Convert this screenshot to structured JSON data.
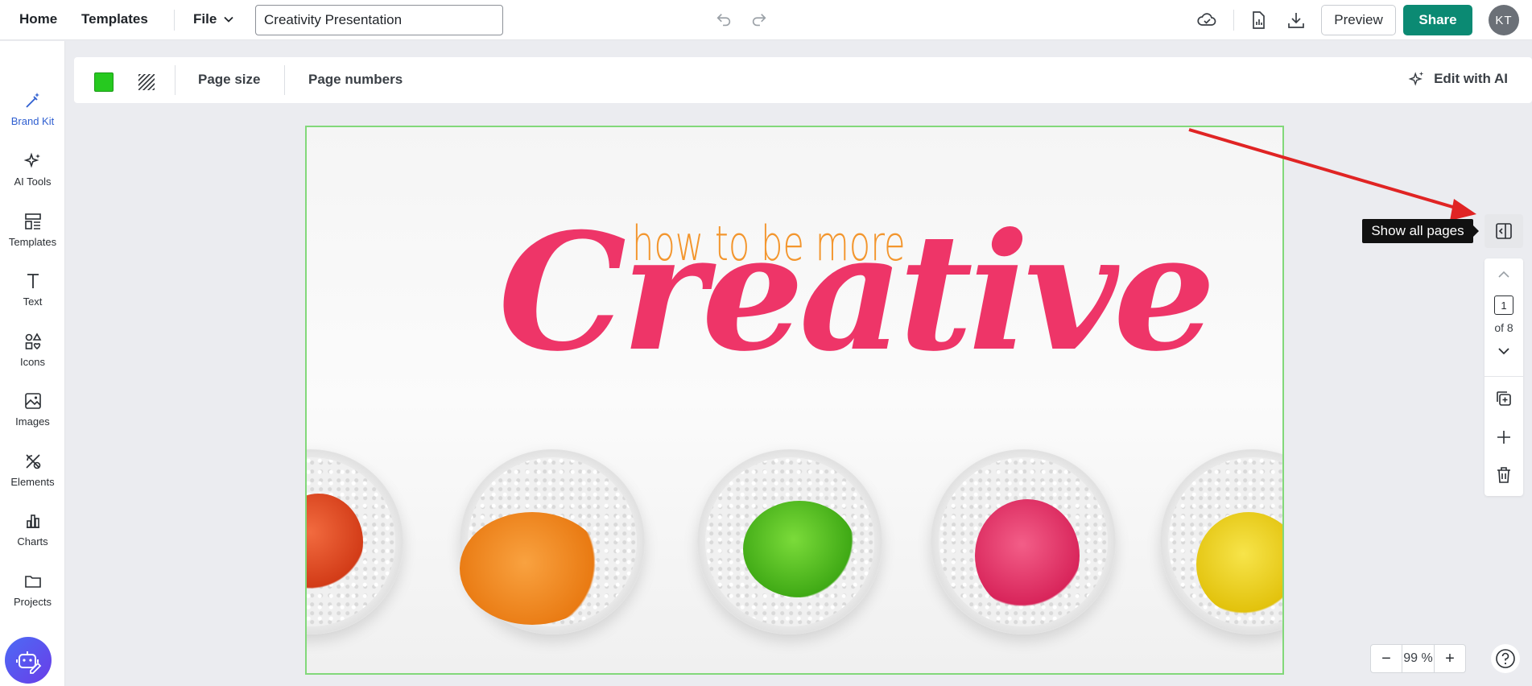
{
  "topbar": {
    "home": "Home",
    "templates": "Templates",
    "file": "File",
    "doc_title": "Creativity Presentation",
    "preview": "Preview",
    "share": "Share",
    "avatar_initials": "KT",
    "accent_color": "#0b8a73"
  },
  "sidebar": {
    "items": [
      {
        "label": "Brand Kit",
        "icon": "magic-wand-icon",
        "active": true
      },
      {
        "label": "AI Tools",
        "icon": "sparkles-icon"
      },
      {
        "label": "Templates",
        "icon": "templates-icon"
      },
      {
        "label": "Text",
        "icon": "text-icon"
      },
      {
        "label": "Icons",
        "icon": "shapes-icon"
      },
      {
        "label": "Images",
        "icon": "image-icon"
      },
      {
        "label": "Elements",
        "icon": "elements-icon"
      },
      {
        "label": "Charts",
        "icon": "bar-chart-icon"
      },
      {
        "label": "Projects",
        "icon": "folder-icon"
      }
    ]
  },
  "toolbar": {
    "background_color": "#26c91f",
    "page_size": "Page size",
    "page_numbers": "Page numbers",
    "edit_ai": "Edit with AI"
  },
  "slide": {
    "subtitle": "how to be more",
    "title": "Creative",
    "plant_colors": [
      "#e8431f",
      "#f58a1f",
      "#4fc21c",
      "#e9346a",
      "#f2d317"
    ]
  },
  "pages": {
    "tooltip": "Show all pages",
    "current": "1",
    "of_label": "of 8"
  },
  "zoom": {
    "minus": "−",
    "value": "99 %",
    "plus": "+"
  }
}
